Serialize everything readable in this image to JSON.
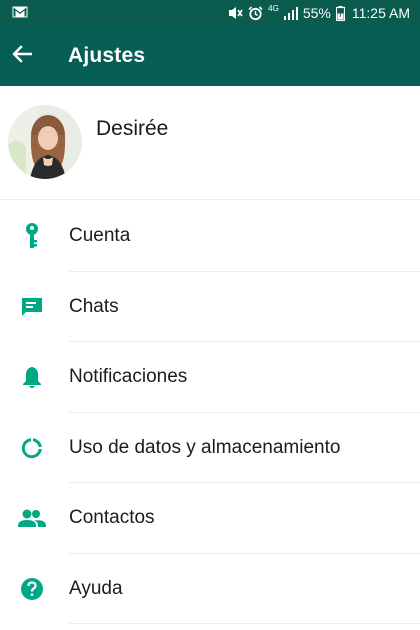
{
  "status_bar": {
    "network_label": "4G",
    "battery_percent": "55%",
    "time": "11:25 AM"
  },
  "app_bar": {
    "title": "Ajustes",
    "back_icon": "arrow-left-icon"
  },
  "profile": {
    "name": "Desirée"
  },
  "menu": {
    "items": [
      {
        "label": "Cuenta",
        "icon": "key-icon"
      },
      {
        "label": "Chats",
        "icon": "chat-icon"
      },
      {
        "label": "Notificaciones",
        "icon": "bell-icon"
      },
      {
        "label": "Uso de datos y almacenamiento",
        "icon": "data-usage-icon"
      },
      {
        "label": "Contactos",
        "icon": "contacts-icon"
      },
      {
        "label": "Ayuda",
        "icon": "help-icon"
      }
    ]
  },
  "colors": {
    "status_bar": "#0b5b4f",
    "app_bar": "#075e54",
    "icon_accent": "#00a884",
    "text": "#1c1c1c"
  }
}
